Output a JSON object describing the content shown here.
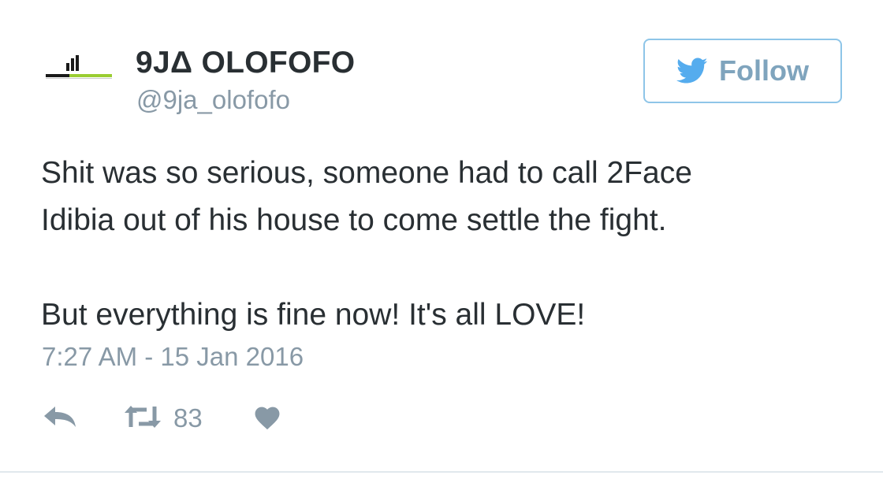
{
  "author": {
    "display_name": "9JΔ OLOFOFO",
    "handle": "@9ja_olofofo"
  },
  "follow_button": {
    "label": "Follow",
    "icon": "twitter-bird-icon"
  },
  "tweet": {
    "lines": [
      "Shit was so serious, someone had to call 2Face",
      "Idibia out of his house to come settle the fight.",
      "",
      "But everything is fine now! It's all LOVE!"
    ],
    "timestamp": "7:27 AM - 15 Jan 2016"
  },
  "actions": {
    "reply_icon": "reply-icon",
    "retweet_icon": "retweet-icon",
    "retweet_count": "83",
    "like_icon": "heart-icon"
  },
  "colors": {
    "text": "#292f33",
    "muted": "#8899a6",
    "twitter_blue": "#55acee",
    "follow_border": "#8ec5e8",
    "logo_green": "#9acd32"
  }
}
